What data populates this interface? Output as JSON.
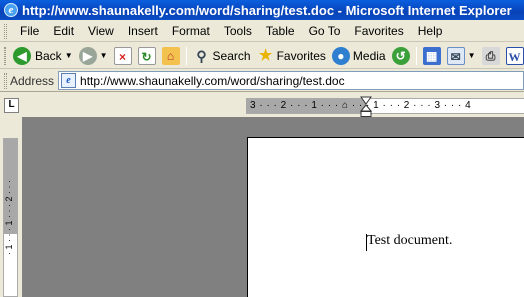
{
  "window": {
    "title": "http://www.shaunakelly.com/word/sharing/test.doc - Microsoft Internet Explorer"
  },
  "menu": [
    "File",
    "Edit",
    "View",
    "Insert",
    "Format",
    "Tools",
    "Table",
    "Go To",
    "Favorites",
    "Help"
  ],
  "toolbar": {
    "back_label": "Back",
    "search_label": "Search",
    "favorites_label": "Favorites",
    "media_label": "Media"
  },
  "address": {
    "label": "Address",
    "url": "http://www.shaunakelly.com/word/sharing/test.doc"
  },
  "ruler": {
    "horizontal": "3 · · · 2 · · · 1 · · · ⌂ · · · 1 · · · 2 · · · 3 · · · 4",
    "vertical": "· 1 · · · 1 · · · 2 · · ·",
    "tab_selector": "L"
  },
  "document": {
    "text": "Test document."
  },
  "colors": {
    "titlebar": "#0a4ec4",
    "chrome": "#ece9d8",
    "workspace": "#808080"
  }
}
